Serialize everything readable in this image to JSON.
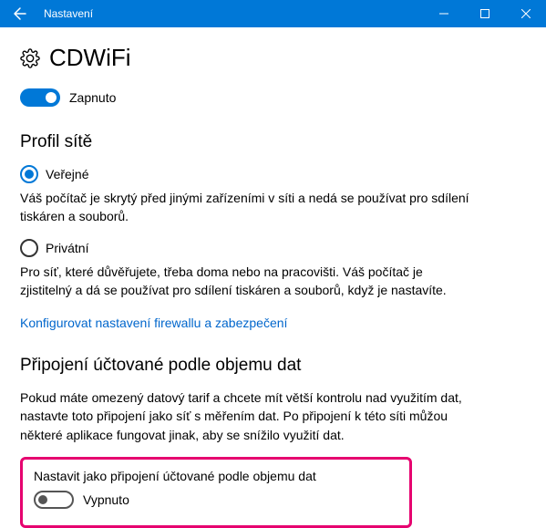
{
  "titlebar": {
    "title": "Nastavení"
  },
  "page": {
    "title": "CDWiFi"
  },
  "mainToggle": {
    "label": "Zapnuto"
  },
  "profile": {
    "heading": "Profil sítě",
    "public": {
      "label": "Veřejné",
      "desc": "Váš počítač je skrytý před jinými zařízeními v síti a nedá se používat pro sdílení tiskáren a souborů."
    },
    "private": {
      "label": "Privátní",
      "desc": "Pro síť, které důvěřujete, třeba doma nebo na pracovišti. Váš počítač je zjistitelný a dá se používat pro sdílení tiskáren a souborů, když je nastavíte."
    },
    "firewallLink": "Konfigurovat nastavení firewallu a zabezpečení"
  },
  "metered": {
    "heading": "Připojení účtované podle objemu dat",
    "desc": "Pokud máte omezený datový tarif a chcete mít větší kontrolu nad využitím dat, nastavte toto připojení jako síť s měřením dat. Po připojení k této síti můžou některé aplikace fungovat jinak, aby se snížilo využití dat.",
    "toggleTitle": "Nastavit jako připojení účtované podle objemu dat",
    "toggleLabel": "Vypnuto"
  }
}
